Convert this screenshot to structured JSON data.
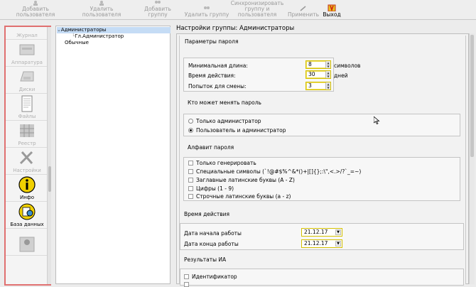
{
  "toolbar": {
    "add_user": "Добавить пользователя",
    "delete_user": "Удалить пользователя",
    "add_group": "Добавить группу",
    "delete_group": "Удалить группу",
    "sync": "Синхронизировать\nгруппу и\nпользователя",
    "apply": "Применить",
    "exit": "Выход"
  },
  "nav": {
    "items": [
      {
        "label": "Журнал",
        "icon": "journal-icon"
      },
      {
        "label": "Аппаратура",
        "icon": "hardware-icon"
      },
      {
        "label": "Диски",
        "icon": "disk-icon"
      },
      {
        "label": "Файлы",
        "icon": "files-icon"
      },
      {
        "label": "Реестр",
        "icon": "registry-icon"
      },
      {
        "label": "Настройки",
        "icon": "settings-icon"
      },
      {
        "label": "Инфо",
        "icon": "info-icon"
      },
      {
        "label": "База данных",
        "icon": "database-icon"
      },
      {
        "label": "",
        "icon": "user-icon"
      }
    ]
  },
  "tree": {
    "administrators": "Администраторы",
    "chief_admin": "Гл.Администратор",
    "regular": "Обычные"
  },
  "panel": {
    "title": "Настройки группы: Администраторы",
    "password_params": {
      "heading": "Параметры пароля",
      "min_length_label": "Минимальная длина:",
      "min_length_value": "8",
      "min_length_unit": "символов",
      "validity_label": "Время действия:",
      "validity_value": "30",
      "validity_unit": "дней",
      "attempts_label": "Попыток для смены:",
      "attempts_value": "3"
    },
    "who_changes": {
      "heading": "Кто может менять пароль",
      "option_admin": "Только администратор",
      "option_user_admin": "Пользователь и администратор"
    },
    "alphabet": {
      "heading": "Алфавит пароля",
      "generate_only": "Только генерировать",
      "special": "Специальные символы (`!@#$%^&*()+|[]{};:\\\",<.>/?`_=~)",
      "upper_latin": "Заглавные латинские буквы (A - Z)",
      "digits": "Цифры (1 - 9)",
      "lower_latin": "Строчные латинские буквы (a - z)"
    },
    "work_time": {
      "heading": "Время действия",
      "start_label": "Дата начала работы",
      "start_value": "21.12.17",
      "end_label": "Дата конца работы",
      "end_value": "21.12.17"
    },
    "ia_results": {
      "heading": "Результаты ИА",
      "identifier": "Идентификатор"
    }
  }
}
